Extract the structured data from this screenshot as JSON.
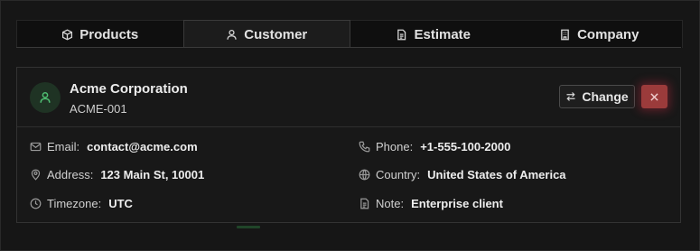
{
  "tabs": [
    {
      "label": "Products",
      "icon": "box-icon",
      "active": false
    },
    {
      "label": "Customer",
      "icon": "user-icon",
      "active": true
    },
    {
      "label": "Estimate",
      "icon": "document-icon",
      "active": false
    },
    {
      "label": "Company",
      "icon": "building-icon",
      "active": false
    }
  ],
  "customer": {
    "name": "Acme Corporation",
    "code": "ACME-001",
    "change_label": "Change",
    "fields": {
      "email": {
        "label": "Email:",
        "value": "contact@acme.com"
      },
      "phone": {
        "label": "Phone:",
        "value": "+1-555-100-2000"
      },
      "address": {
        "label": "Address:",
        "value": "123 Main St, 10001"
      },
      "country": {
        "label": "Country:",
        "value": "United States of America"
      },
      "timezone": {
        "label": "Timezone:",
        "value": "UTC"
      },
      "note": {
        "label": "Note:",
        "value": "Enterprise client"
      }
    }
  },
  "colors": {
    "background": "#121212",
    "avatar_accent": "#4fbf72",
    "danger": "#9b3b3b"
  }
}
